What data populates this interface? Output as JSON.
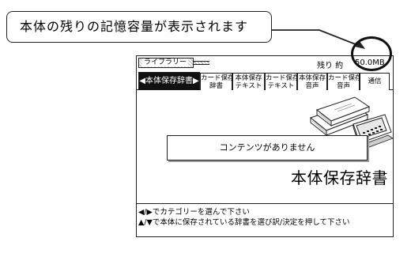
{
  "callout": {
    "text": "本体の残りの記憶容量が表示されます"
  },
  "screen": {
    "library_label": "ライブラリー",
    "remaining_label": "残り 約",
    "remaining_value": "50.0MB",
    "tabs": [
      {
        "label": "◀本体保存辞書▶",
        "active": true
      },
      {
        "label": "カード保存\n辞書",
        "active": false
      },
      {
        "label": "本体保存\nテキスト",
        "active": false
      },
      {
        "label": "カード保存\nテキスト",
        "active": false
      },
      {
        "label": "本体保存\n音声",
        "active": false
      },
      {
        "label": "カード保存\n音声",
        "active": false
      },
      {
        "label": "通信",
        "active": false
      }
    ],
    "message": "コンテンツがありません",
    "section_title": "本体保存辞書",
    "help_line_1": "◀/▶でカテゴリーを選んで下さい",
    "help_line_2": "▲/▼で本体に保存されている辞書を選び訳/決定を押して下さい"
  },
  "icons": {
    "illustration": "books-and-device-illustration",
    "highlight": "highlight-circle"
  }
}
